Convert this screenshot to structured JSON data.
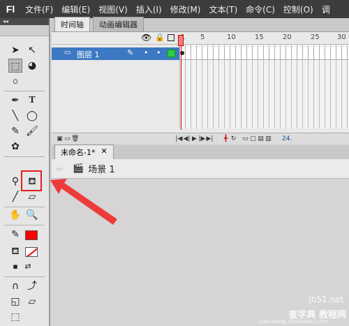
{
  "menubar": {
    "logo": "Fl",
    "items": [
      "文件(F)",
      "编辑(E)",
      "视图(V)",
      "插入(I)",
      "修改(M)",
      "文本(T)",
      "命令(C)",
      "控制(O)",
      "调"
    ]
  },
  "toolbox": {
    "header": "◂◂"
  },
  "timeline": {
    "tabs": [
      "时间轴",
      "动画编辑器"
    ],
    "frame_numbers": [
      "1",
      "5",
      "10",
      "15",
      "20",
      "25",
      "30"
    ],
    "layer_name": "图层 1",
    "fps": "24."
  },
  "document": {
    "tab_label": "未命名-1*",
    "close": "✕",
    "scene_label": "场景 1"
  },
  "colors": {
    "stroke": "#ff0000",
    "highlight": "#e02020",
    "layer_selected": "#3d79c3"
  },
  "watermark": {
    "line1": "jb51.net",
    "line2": "查字典 教程网",
    "line3": "jiaocheng.chazidian.com"
  }
}
